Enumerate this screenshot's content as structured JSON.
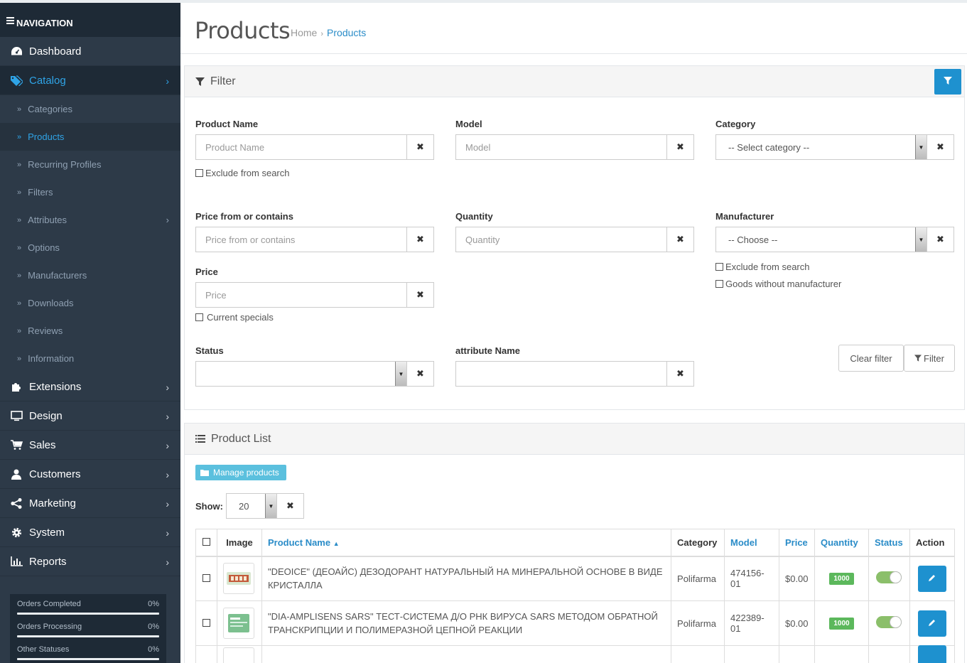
{
  "sidebar": {
    "header": "NAVIGATION",
    "menu": [
      {
        "label": "Dashboard",
        "icon": "dashboard-icon"
      },
      {
        "label": "Catalog",
        "icon": "tags-icon"
      }
    ],
    "catalog_sub": [
      {
        "label": "Categories"
      },
      {
        "label": "Products"
      },
      {
        "label": "Recurring Profiles"
      },
      {
        "label": "Filters"
      },
      {
        "label": "Attributes"
      },
      {
        "label": "Options"
      },
      {
        "label": "Manufacturers"
      },
      {
        "label": "Downloads"
      },
      {
        "label": "Reviews"
      },
      {
        "label": "Information"
      }
    ],
    "menu_bottom": [
      {
        "label": "Extensions",
        "icon": "puzzle-icon"
      },
      {
        "label": "Design",
        "icon": "monitor-icon"
      },
      {
        "label": "Sales",
        "icon": "cart-icon"
      },
      {
        "label": "Customers",
        "icon": "user-icon"
      },
      {
        "label": "Marketing",
        "icon": "share-icon"
      },
      {
        "label": "System",
        "icon": "gear-icon"
      },
      {
        "label": "Reports",
        "icon": "bar-chart-icon"
      }
    ],
    "stats": [
      {
        "label": "Orders Completed",
        "value": "0%"
      },
      {
        "label": "Orders Processing",
        "value": "0%"
      },
      {
        "label": "Other Statuses",
        "value": "0%"
      }
    ]
  },
  "header": {
    "title": "Products",
    "breadcrumb": [
      "Home",
      "Products"
    ],
    "breadcrumb_sep": "›"
  },
  "filter": {
    "title": "Filter",
    "product_name": {
      "label": "Product Name",
      "placeholder": "Product Name",
      "exclude": "Exclude from search"
    },
    "model": {
      "label": "Model",
      "placeholder": "Model"
    },
    "category": {
      "label": "Category",
      "value": "-- Select category --"
    },
    "price_from": {
      "label": "Price from or contains",
      "placeholder": "Price from or contains"
    },
    "quantity": {
      "label": "Quantity",
      "placeholder": "Quantity"
    },
    "manufacturer": {
      "label": "Manufacturer",
      "value": "-- Choose --",
      "exclude": "Exclude from search",
      "without": "Goods without manufacturer"
    },
    "price": {
      "label": "Price",
      "placeholder": "Price",
      "specials": "Current specials"
    },
    "status": {
      "label": "Status",
      "value": ""
    },
    "attribute": {
      "label": "attribute Name",
      "placeholder": ""
    },
    "clear_label": "Clear filter",
    "filter_label": "Filter",
    "clear_x": "✖"
  },
  "product_list": {
    "title": "Product List",
    "manage_label": "Manage products",
    "show_label": "Show:",
    "show_value": "20",
    "columns": {
      "image": "Image",
      "name": "Product Name",
      "category": "Category",
      "model": "Model",
      "price": "Price",
      "quantity": "Quantity",
      "status": "Status",
      "action": "Action"
    },
    "rows": [
      {
        "name": "\"DEOICE\" (ДЕОАЙС) ДЕЗОДОРАНТ НАТУРАЛЬНЫЙ НА МИНЕРАЛЬНОЙ ОСНОВЕ В ВИДЕ КРИСТАЛЛА",
        "category": "Polifarma",
        "model": "474156-01",
        "price": "$0.00",
        "quantity": "1000",
        "status_on": true
      },
      {
        "name": "\"DIA-AMPLISENS SARS\" ТЕСТ-СИСТЕМА Д/О РНК ВИРУСА SARS МЕТОДОМ ОБРАТНОЙ ТРАНСКРИПЦИИ И ПОЛИМЕРАЗНОЙ ЦЕПНОЙ РЕАКЦИИ",
        "category": "Polifarma",
        "model": "422389-01",
        "price": "$0.00",
        "quantity": "1000",
        "status_on": true
      }
    ]
  },
  "colors": {
    "accent": "#1e91cf",
    "sidebar_bg": "#2d3a48",
    "sidebar_dark": "#1e2a36",
    "active_link": "#2fa4e7",
    "success": "#5cb85c",
    "info": "#5bc0de"
  }
}
